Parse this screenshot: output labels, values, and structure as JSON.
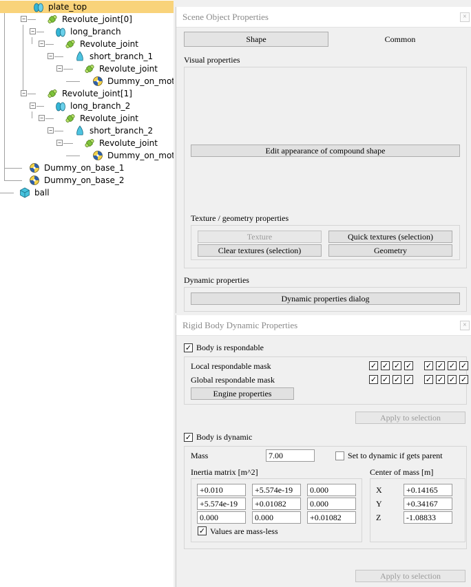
{
  "hierarchy": {
    "nodes": [
      {
        "label": "plate_top",
        "icon": "plate-shape-icon"
      },
      {
        "label": "Revolute_joint[0]",
        "icon": "revolute-joint-icon"
      },
      {
        "label": "long_branch",
        "icon": "plate-shape-icon"
      },
      {
        "label": "Revolute_joint",
        "icon": "revolute-joint-icon"
      },
      {
        "label": "short_branch_1",
        "icon": "shape-icon"
      },
      {
        "label": "Revolute_joint",
        "icon": "revolute-joint-icon"
      },
      {
        "label": "Dummy_on_moto",
        "icon": "dummy-icon"
      },
      {
        "label": "Revolute_joint[1]",
        "icon": "revolute-joint-icon"
      },
      {
        "label": "long_branch_2",
        "icon": "plate-shape-icon"
      },
      {
        "label": "Revolute_joint",
        "icon": "revolute-joint-icon"
      },
      {
        "label": "short_branch_2",
        "icon": "shape-icon"
      },
      {
        "label": "Revolute_joint",
        "icon": "revolute-joint-icon"
      },
      {
        "label": "Dummy_on_moto",
        "icon": "dummy-icon"
      },
      {
        "label": "Dummy_on_base_1",
        "icon": "dummy-icon"
      },
      {
        "label": "Dummy_on_base_2",
        "icon": "dummy-icon"
      },
      {
        "label": "ball",
        "icon": "cube-shape-icon"
      }
    ]
  },
  "scene_props": {
    "title": "Scene Object Properties",
    "close": "×",
    "tab_shape": "Shape",
    "tab_common": "Common",
    "visual_heading": "Visual properties",
    "edit_appearance": "Edit appearance of compound shape",
    "texture_heading": "Texture / geometry properties",
    "texture": "Texture",
    "quick_textures": "Quick textures (selection)",
    "clear_textures": "Clear textures (selection)",
    "geometry": "Geometry",
    "dynamic_heading": "Dynamic properties",
    "dynamic_dialog": "Dynamic properties dialog"
  },
  "rigid_body": {
    "title": "Rigid Body Dynamic Properties",
    "close": "×",
    "respondable_label": "Body is respondable",
    "local_mask": "Local respondable mask",
    "global_mask": "Global respondable mask",
    "engine_props": "Engine properties",
    "apply1": "Apply to selection",
    "dynamic_label": "Body is dynamic",
    "mass_label": "Mass",
    "mass_value": "7.00",
    "set_dynamic_label": "Set to dynamic if gets parent",
    "inertia_heading": "Inertia matrix [m^2]",
    "inertia": [
      "+0.010",
      "+5.574e-19",
      "0.000",
      "+5.574e-19",
      "+0.01082",
      "0.000",
      "0.000",
      "0.000",
      "+0.01082"
    ],
    "massless_label": "Values are mass-less",
    "com_heading": "Center of mass [m]",
    "com_x_label": "X",
    "com_x": "+0.14165",
    "com_y_label": "Y",
    "com_y": "+0.34167",
    "com_z_label": "Z",
    "com_z": "-1.08833",
    "apply2": "Apply to selection",
    "check_mark": "✓"
  }
}
